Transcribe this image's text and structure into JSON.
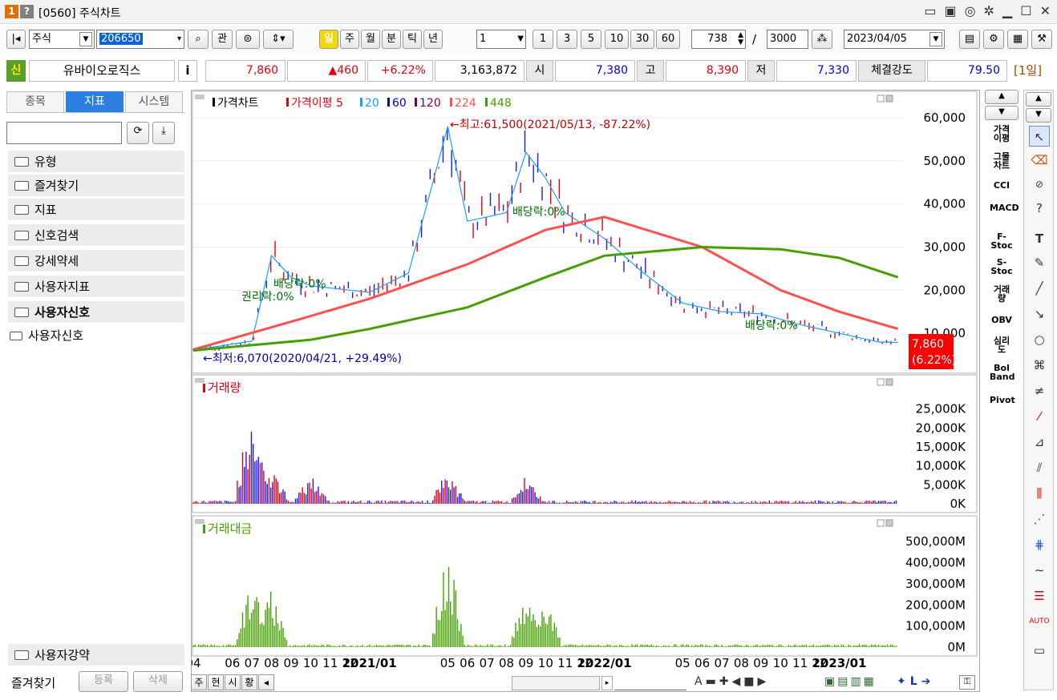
{
  "window": {
    "num_badge": "1",
    "help_badge": "?",
    "title": "[0560] 주식차트"
  },
  "toolbar": {
    "market": "주식",
    "code": "206650",
    "gwan": "관",
    "periods": [
      "일",
      "주",
      "월",
      "분",
      "틱",
      "년"
    ],
    "interval_value": "1",
    "quick_intervals": [
      "1",
      "3",
      "5",
      "10",
      "30",
      "60"
    ],
    "count": "738",
    "slash": "/",
    "total": "3000",
    "date": "2023/04/05"
  },
  "quote": {
    "badge": "신",
    "name": "유바이오로직스",
    "info": "i",
    "price": "7,860",
    "change": "▲460",
    "rate": "+6.22%",
    "volume": "3,163,872",
    "open_label": "시",
    "open": "7,380",
    "high_label": "고",
    "high": "8,390",
    "low_label": "저",
    "low": "7,330",
    "strength_label": "체결강도",
    "strength": "79.50",
    "period_tag": "[1일]"
  },
  "left_panel": {
    "tabs": [
      "종목",
      "지표",
      "시스템"
    ],
    "folders": [
      "유형",
      "즐겨찾기",
      "지표",
      "신호검색",
      "강세약세",
      "사용자지표",
      "사용자신호"
    ],
    "subitem": "사용자신호",
    "bottom_folder": "사용자강약",
    "footer": {
      "label": "즐겨찾기",
      "register": "등록",
      "delete": "삭제"
    }
  },
  "colors": {
    "up": "#e60012",
    "down": "#1a1aff",
    "ma5": "#e60012",
    "ma20": "#1aa0ff",
    "ma60": "#0000cc",
    "ma120": "#800040",
    "ma224": "#ff5050",
    "ma448": "#44a000",
    "accent": "#f5d800"
  },
  "chart_data": [
    {
      "type": "line",
      "title": "가격차트",
      "legend": [
        "가격차트",
        "가격이평 5",
        "20",
        "60",
        "120",
        "224",
        "448"
      ],
      "x_tick_labels": [
        "04",
        "06",
        "07",
        "08",
        "09",
        "10",
        "11",
        "12",
        "2021/01",
        "05",
        "06",
        "07",
        "08",
        "09",
        "10",
        "11",
        "12",
        "2022/01",
        "05",
        "06",
        "07",
        "08",
        "09",
        "10",
        "11",
        "12",
        "2023/01"
      ],
      "y_tick_labels": [
        "60,000",
        "50,000",
        "40,000",
        "30,000",
        "20,000",
        "10,000"
      ],
      "ylim": [
        5000,
        63000
      ],
      "series": [
        {
          "name": "가격차트",
          "x": [
            "2020/04",
            "2020/06",
            "2020/07",
            "2020/08",
            "2020/09",
            "2020/10",
            "2020/12",
            "2021/01",
            "2021/03",
            "2021/05",
            "2021/06",
            "2021/08",
            "2021/09",
            "2021/10",
            "2021/11",
            "2021/12",
            "2022/01",
            "2022/03",
            "2022/05",
            "2022/07",
            "2022/09",
            "2022/11",
            "2023/01",
            "2023/03",
            "2023/04"
          ],
          "values": [
            6100,
            7500,
            8200,
            28000,
            23000,
            21000,
            20000,
            19500,
            24000,
            58000,
            36000,
            38000,
            52000,
            46000,
            38000,
            35000,
            32000,
            24000,
            17000,
            15000,
            14500,
            12000,
            10000,
            8000,
            7860
          ]
        },
        {
          "name": "224",
          "x": [
            "2020/04",
            "2020/10",
            "2021/01",
            "2021/06",
            "2021/10",
            "2022/01",
            "2022/06",
            "2022/10",
            "2023/01",
            "2023/04"
          ],
          "values": [
            6200,
            14000,
            18000,
            26000,
            34000,
            37000,
            30000,
            20000,
            15000,
            11000
          ]
        },
        {
          "name": "448",
          "x": [
            "2020/04",
            "2020/10",
            "2021/01",
            "2021/06",
            "2021/10",
            "2022/01",
            "2022/06",
            "2022/10",
            "2023/01",
            "2023/04"
          ],
          "values": [
            6000,
            8500,
            11000,
            16000,
            23000,
            28000,
            30000,
            29500,
            27500,
            23000
          ]
        }
      ],
      "annotations": [
        "←최고:61,500(2021/05/13, -87.22%)",
        "←최저:6,070(2020/04/21, +29.49%)",
        "권리락:0%",
        "배당락:0%",
        "배당락:0%",
        "배당락:0%"
      ],
      "last_price": "7,860",
      "last_rate": "(6.22%)"
    },
    {
      "type": "bar",
      "title": "거래량",
      "y_tick_labels": [
        "25,000K",
        "20,000K",
        "15,000K",
        "10,000K",
        "5,000K",
        "0K"
      ],
      "ylim": [
        0,
        30000
      ],
      "peaks": [
        {
          "x": "2020/07",
          "value": 27000
        },
        {
          "x": "2020/08",
          "value": 11000
        },
        {
          "x": "2020/10",
          "value": 8000
        },
        {
          "x": "2021/05",
          "value": 9000
        },
        {
          "x": "2021/09",
          "value": 7500
        }
      ]
    },
    {
      "type": "bar",
      "title": "거래대금",
      "y_tick_labels": [
        "500,000M",
        "400,000M",
        "300,000M",
        "200,000M",
        "100,000M",
        "0M"
      ],
      "ylim": [
        0,
        550000
      ],
      "peaks": [
        {
          "x": "2020/07",
          "value": 330000
        },
        {
          "x": "2020/08",
          "value": 280000
        },
        {
          "x": "2021/05",
          "value": 470000
        },
        {
          "x": "2021/09",
          "value": 280000
        },
        {
          "x": "2021/10",
          "value": 230000
        }
      ]
    }
  ],
  "right_indicators": [
    "가격이평",
    "그물차트",
    "CCI",
    "MACD",
    "F-Stoc",
    "S-Stoc",
    "거래량",
    "OBV",
    "심리도",
    "Bol Band",
    "Pivot"
  ],
  "bottom_bar": {
    "buttons": [
      "주",
      "현",
      "시",
      "황"
    ],
    "scroll_right": "◂"
  }
}
